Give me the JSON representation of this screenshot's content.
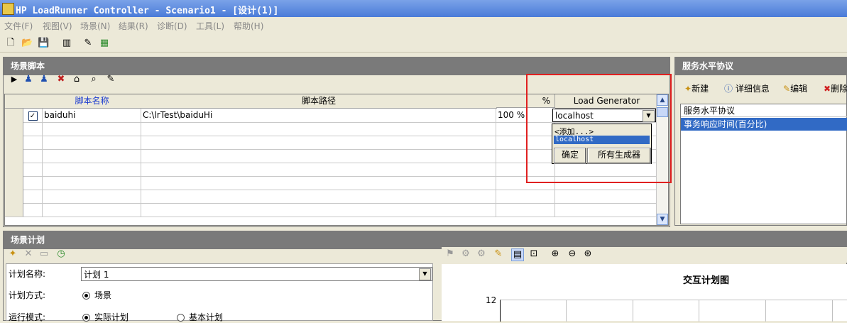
{
  "window": {
    "title": "HP LoadRunner Controller - Scenario1 - [设计(1)]"
  },
  "menu": [
    "文件(F)",
    "视图(V)",
    "场景(N)",
    "结果(R)",
    "诊断(D)",
    "工具(L)",
    "帮助(H)"
  ],
  "scripts_panel": {
    "title": "场景脚本",
    "columns": {
      "name": "脚本名称",
      "path": "脚本路径",
      "percent": "%",
      "lg": "Load Generator"
    },
    "rows": [
      {
        "checked": true,
        "name": "baiduhi",
        "path": "C:\\lrTest\\baiduHi",
        "percent": "100 %",
        "lg": "localhost"
      }
    ],
    "lg_popup": {
      "items": [
        "<添加...>",
        "localhost"
      ],
      "selected": "localhost",
      "ok_label": "确定",
      "all_label": "所有生成器"
    }
  },
  "sla_panel": {
    "title": "服务水平协议",
    "new_label": "新建",
    "details_label": "详细信息",
    "edit_label": "编辑",
    "delete_label": "删除",
    "list_header": "服务水平协议",
    "items": [
      "事务响应时间(百分比)"
    ]
  },
  "schedule_panel": {
    "title": "场景计划",
    "plan_name_label": "计划名称:",
    "plan_name_value": "计划 1",
    "plan_mode_label": "计划方式:",
    "plan_mode_value": "场景",
    "run_mode_label": "运行模式:",
    "run_mode_options": [
      "实际计划",
      "基本计划"
    ],
    "run_mode_selected": "实际计划",
    "chart_title": "交互计划图",
    "chart_ytick": "12"
  },
  "colors": {
    "accent": "#316ac5",
    "highlight_box": "#e02020"
  }
}
